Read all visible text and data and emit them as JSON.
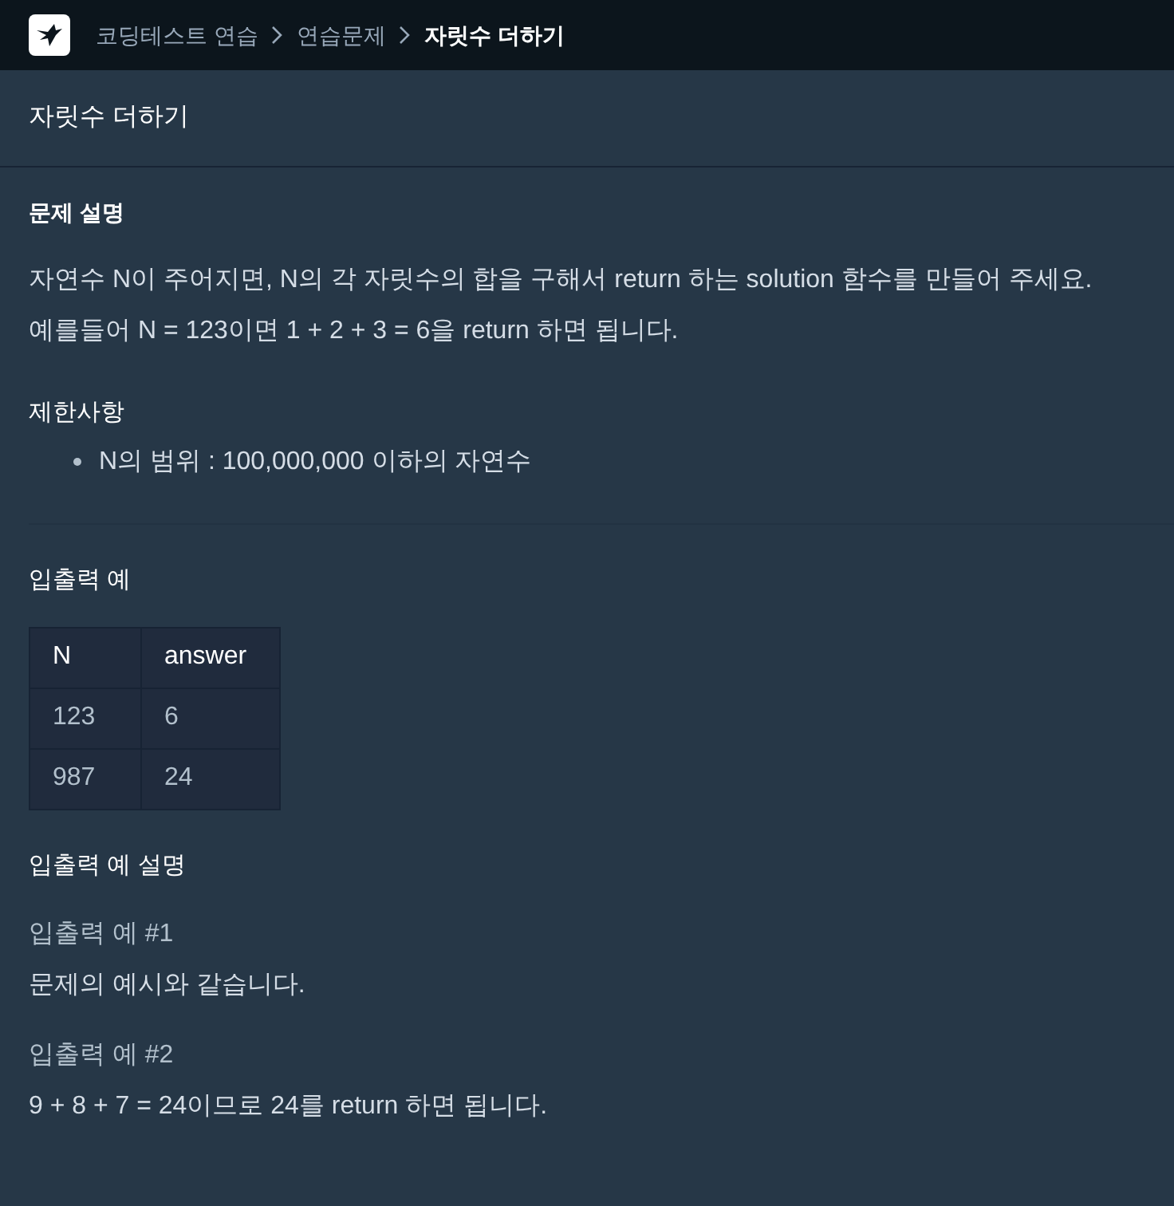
{
  "breadcrumb": [
    {
      "label": "코딩테스트 연습",
      "current": false
    },
    {
      "label": "연습문제",
      "current": false
    },
    {
      "label": "자릿수 더하기",
      "current": true
    }
  ],
  "title": "자릿수 더하기",
  "description": {
    "heading": "문제 설명",
    "lines": [
      "자연수 N이 주어지면, N의 각 자릿수의 합을 구해서 return 하는 solution 함수를 만들어 주세요.",
      "예를들어 N = 123이면 1 + 2 + 3 = 6을 return 하면 됩니다."
    ]
  },
  "constraints": {
    "heading": "제한사항",
    "items": [
      "N의 범위 : 100,000,000 이하의 자연수"
    ]
  },
  "examples": {
    "heading": "입출력 예",
    "columns": [
      "N",
      "answer"
    ],
    "rows": [
      [
        "123",
        "6"
      ],
      [
        "987",
        "24"
      ]
    ]
  },
  "explanation": {
    "heading": "입출력 예 설명",
    "cases": [
      {
        "title": "입출력 예 #1",
        "text": "문제의 예시와 같습니다."
      },
      {
        "title": "입출력 예 #2",
        "text": "9 + 8 + 7 = 24이므로 24를 return 하면 됩니다."
      }
    ]
  }
}
